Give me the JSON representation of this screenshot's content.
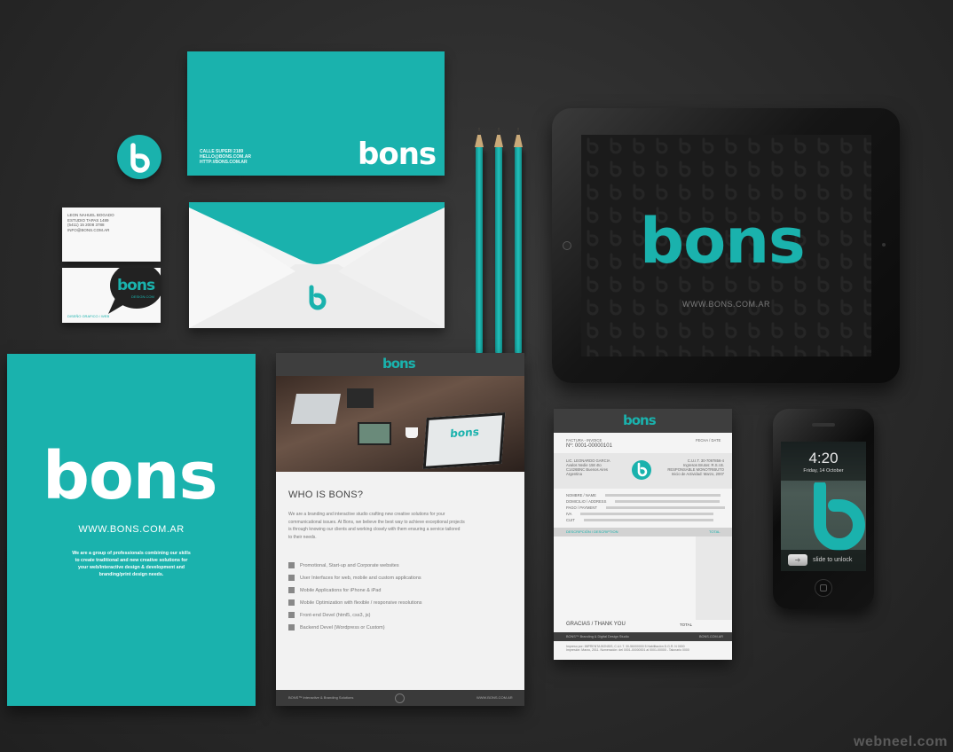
{
  "colors": {
    "brand_teal": "#1ab2ad",
    "dark_gray": "#3e3e3e",
    "background": "#2b2b2b"
  },
  "brand": {
    "wordmark": "bons",
    "icon_letter": "b"
  },
  "envelope_top": {
    "address_lines": [
      "CALLE SUPERI 2189",
      "HELLO@BONS.COM.AR",
      "HTTP://BONS.COM.AR"
    ]
  },
  "business_card_front": {
    "lines": [
      "LEON NAHUEL BOGADO",
      "ESTUDIO TAPAS 1489",
      "(5411) 15 2008 3788",
      "INFO@BONS.COM.AR"
    ]
  },
  "business_card_back": {
    "logo_sub": "DESIGN.COM",
    "footer": "DISEÑO GRAFICO / WEB"
  },
  "ipad": {
    "url": "WWW.BONS.COM.AR"
  },
  "folder": {
    "url": "WWW.BONS.COM.AR",
    "description_lines": [
      "We are a group of professionals combining our skills",
      "to create traditional and new creative solutions for",
      "your web/interactive design & development and",
      "branding/print design needs."
    ]
  },
  "brochure": {
    "title": "WHO IS BONS?",
    "intro_lines": [
      "We are a branding and interactive studio crafting new creative solutions for your",
      "communicational issues. At Bons, we believe the best way to achieve exceptional projects",
      "is through knowing our clients and working closely with them ensuring a service tailored",
      "to their needs."
    ],
    "services": [
      "Promotional, Start-up and Corporate websites",
      "User Interfaces for web, mobile and custom applications",
      "Mobile Applications for iPhone & iPad",
      "Mobile Optimization with flexible / responsive resolutions",
      "Front-end Devel (html5, css3, js)",
      "Backend Devel (Wordpress or Custom)"
    ],
    "footer_left": "BONS™ Interactive & Branding Solutions",
    "footer_right": "WWW.BONS.COM.AR",
    "laptop_logo": "bons"
  },
  "invoice": {
    "label_type": "FACTURA - INVOICE",
    "number": "Nº: 0001-00000101",
    "date_label": "FECHA / DATE",
    "client_lines": [
      "LIC. LEONARDO GARCIA",
      "Avalos Nedie 158 4to",
      "C1426BNC Buenos Aires",
      "Argentina"
    ],
    "tax_lines": [
      "C.U.I.T. 30-7097856-4",
      "Ingresos Brutos: R.S.I.B.",
      "RESPONSABLE MONOTRIBUTO",
      "Inicio de Actividad: Marzo, 2007"
    ],
    "field_labels": [
      "NOMBRE / NAME",
      "DOMICILIO / ADDRESS",
      "PAGO / PAYMENT",
      "IVA",
      "CUIT"
    ],
    "table_headers": [
      "DESCRIPCIÓN / DESCRIPTION",
      "TOTAL"
    ],
    "thanks": "GRACIAS / THANK YOU",
    "total_label": "TOTAL",
    "footer_left": "BONS™ Branding & Digital Design Studio",
    "footer_right": "BONS.COM.AR",
    "bottom_lines": [
      "Impreso por: IMPRENTA BONSIS, C.U.I.T. 30-56000000 5 Habilitación D.G.R. N 0000",
      "Impresión: Marzo, 2011. Numeración: del 0001-00000001 al 0001-00000 - Talonario 0000"
    ]
  },
  "iphone": {
    "time": "4:20",
    "date": "Friday, 14 October",
    "unlock": "slide to unlock"
  },
  "watermark": "webneel.com"
}
